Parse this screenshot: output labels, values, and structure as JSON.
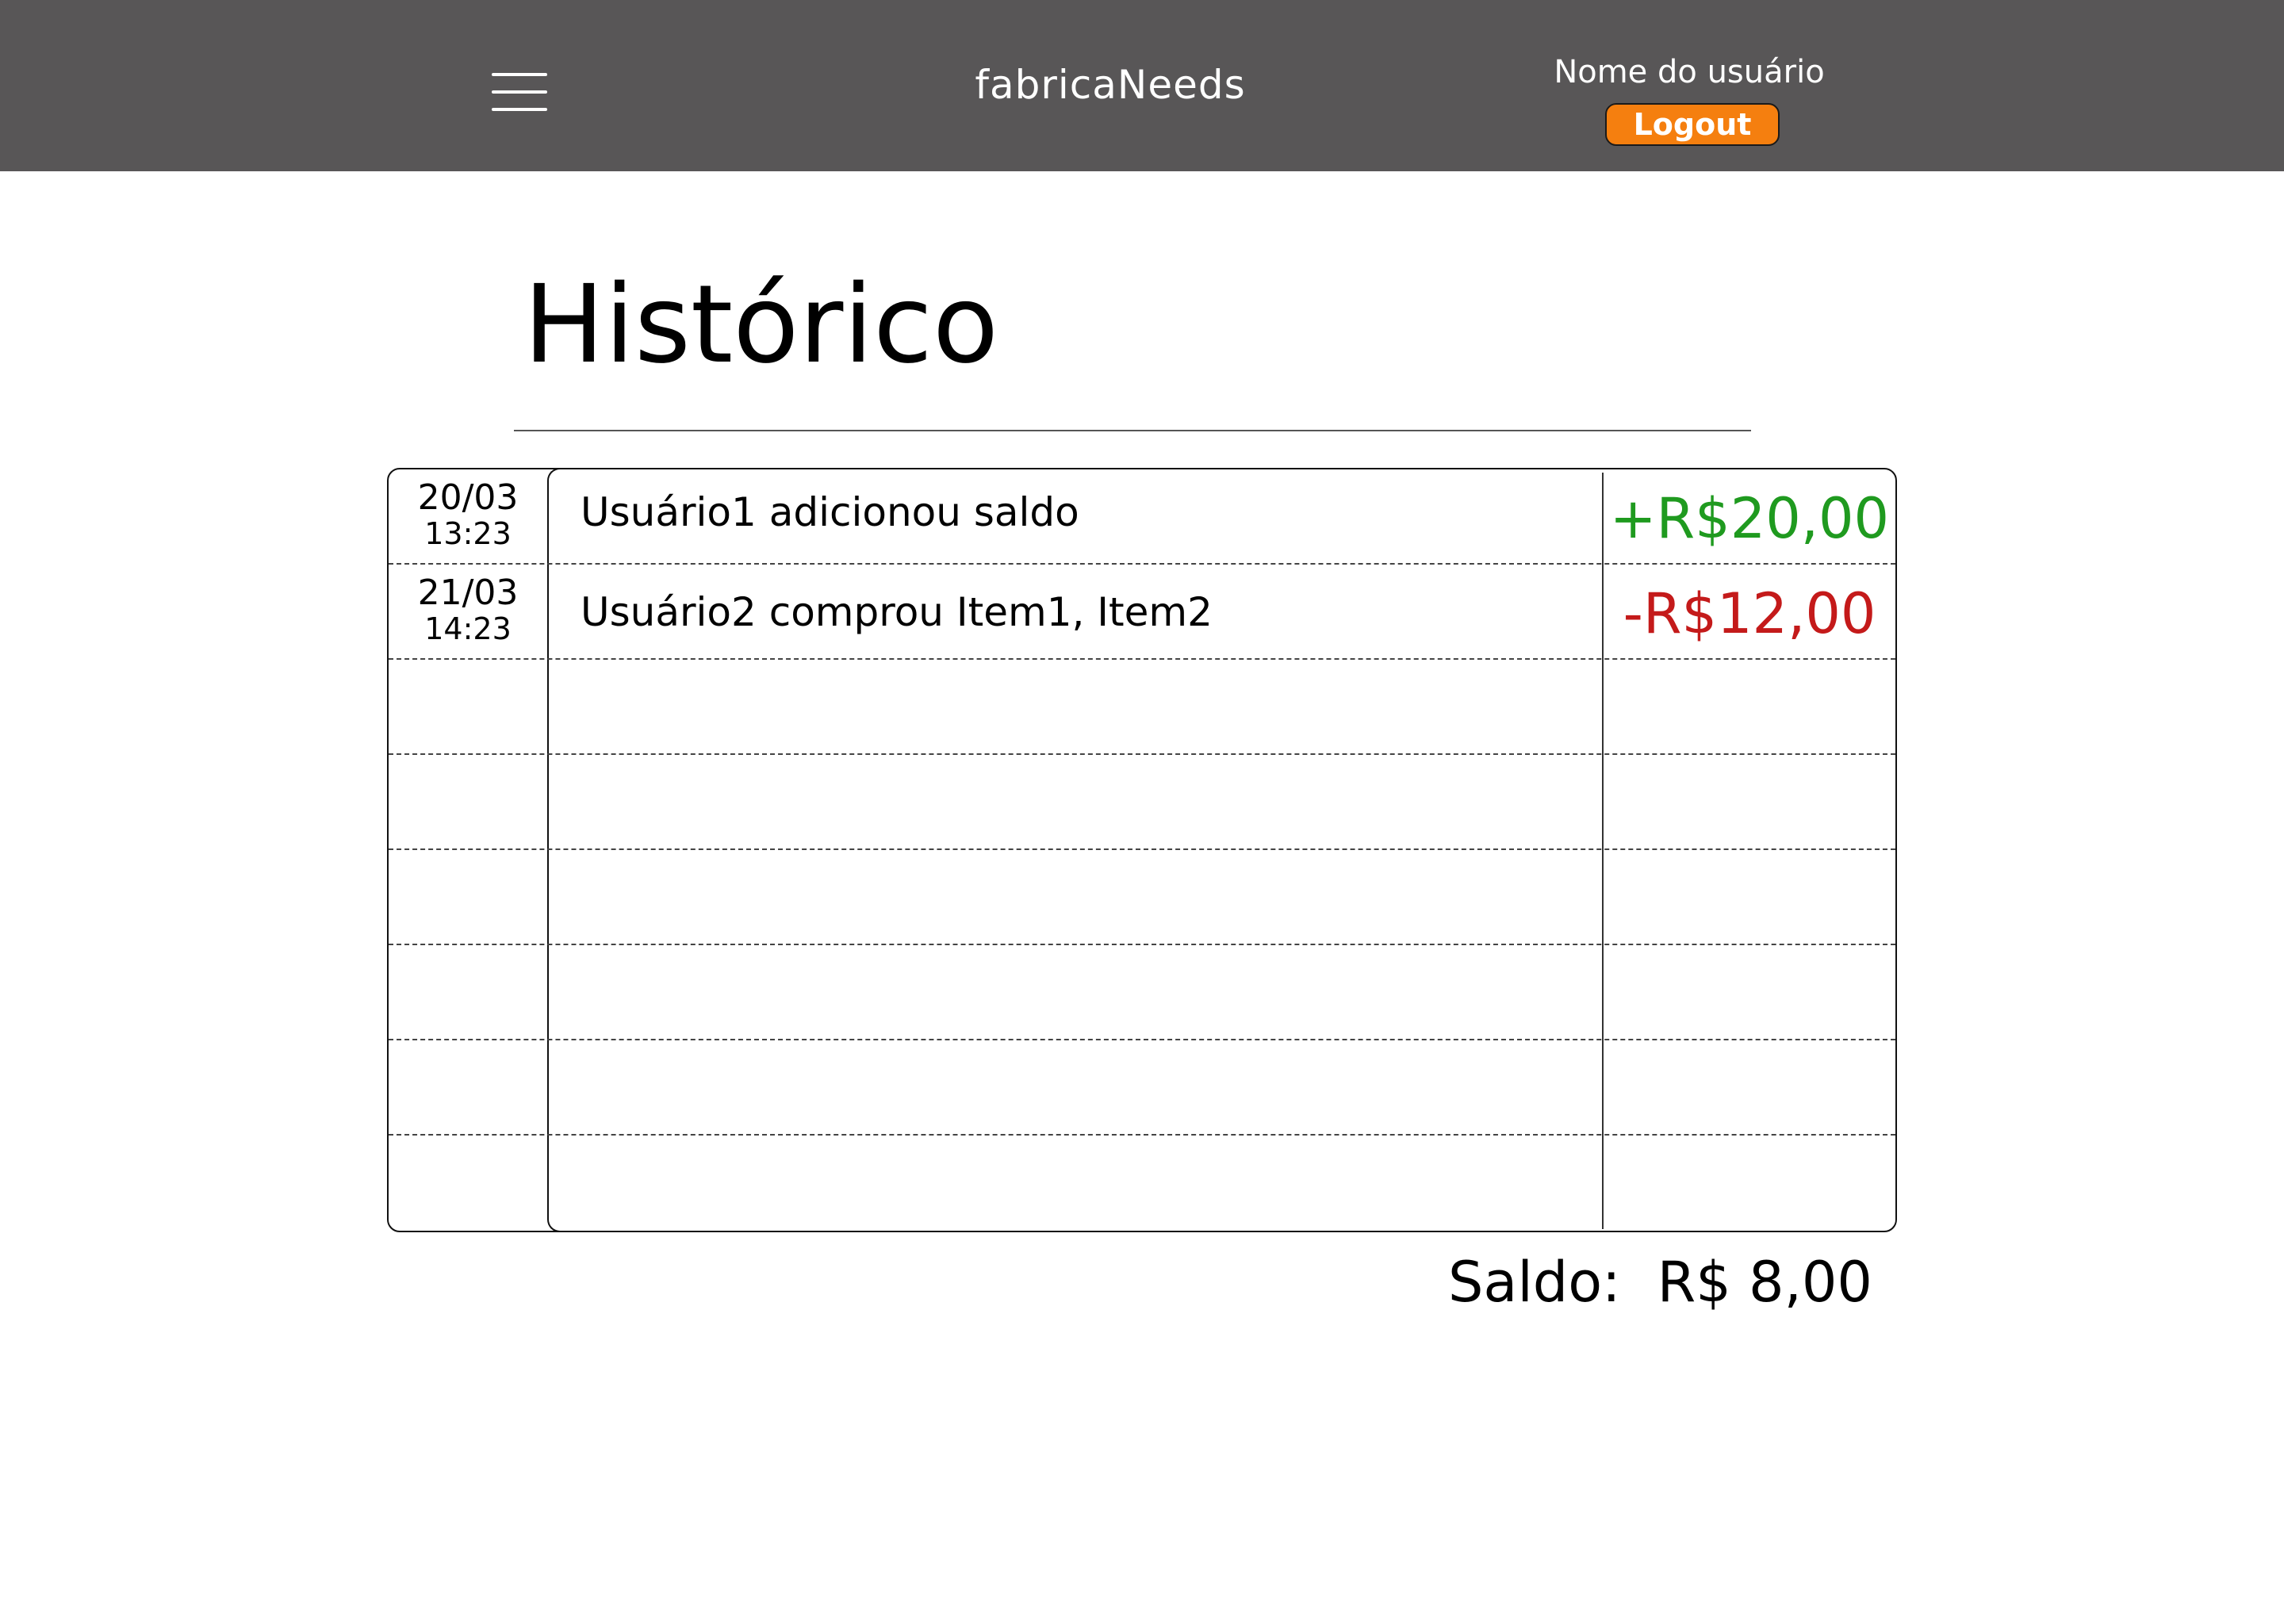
{
  "header": {
    "app_title": "fabricaNeeds",
    "user_name": "Nome do usuário",
    "logout_label": "Logout",
    "menu_icon": "hamburger-menu-icon",
    "background_color": "#585657",
    "logout_color": "#f57f0f"
  },
  "page": {
    "title": "Histórico"
  },
  "history": {
    "rows": [
      {
        "date": "20/03",
        "time": "13:23",
        "description": "Usuário1 adicionou saldo",
        "amount": "+R$20,00",
        "amount_color": "#1f9a1f"
      },
      {
        "date": "21/03",
        "time": "14:23",
        "description": "Usuário2 comprou Item1, Item2",
        "amount": "-R$12,00",
        "amount_color": "#c41a1a"
      },
      {
        "date": "",
        "time": "",
        "description": "",
        "amount": ""
      },
      {
        "date": "",
        "time": "",
        "description": "",
        "amount": ""
      },
      {
        "date": "",
        "time": "",
        "description": "",
        "amount": ""
      },
      {
        "date": "",
        "time": "",
        "description": "",
        "amount": ""
      },
      {
        "date": "",
        "time": "",
        "description": "",
        "amount": ""
      },
      {
        "date": "",
        "time": "",
        "description": "",
        "amount": ""
      }
    ]
  },
  "balance": {
    "label": "Saldo:",
    "value": "R$ 8,00"
  }
}
